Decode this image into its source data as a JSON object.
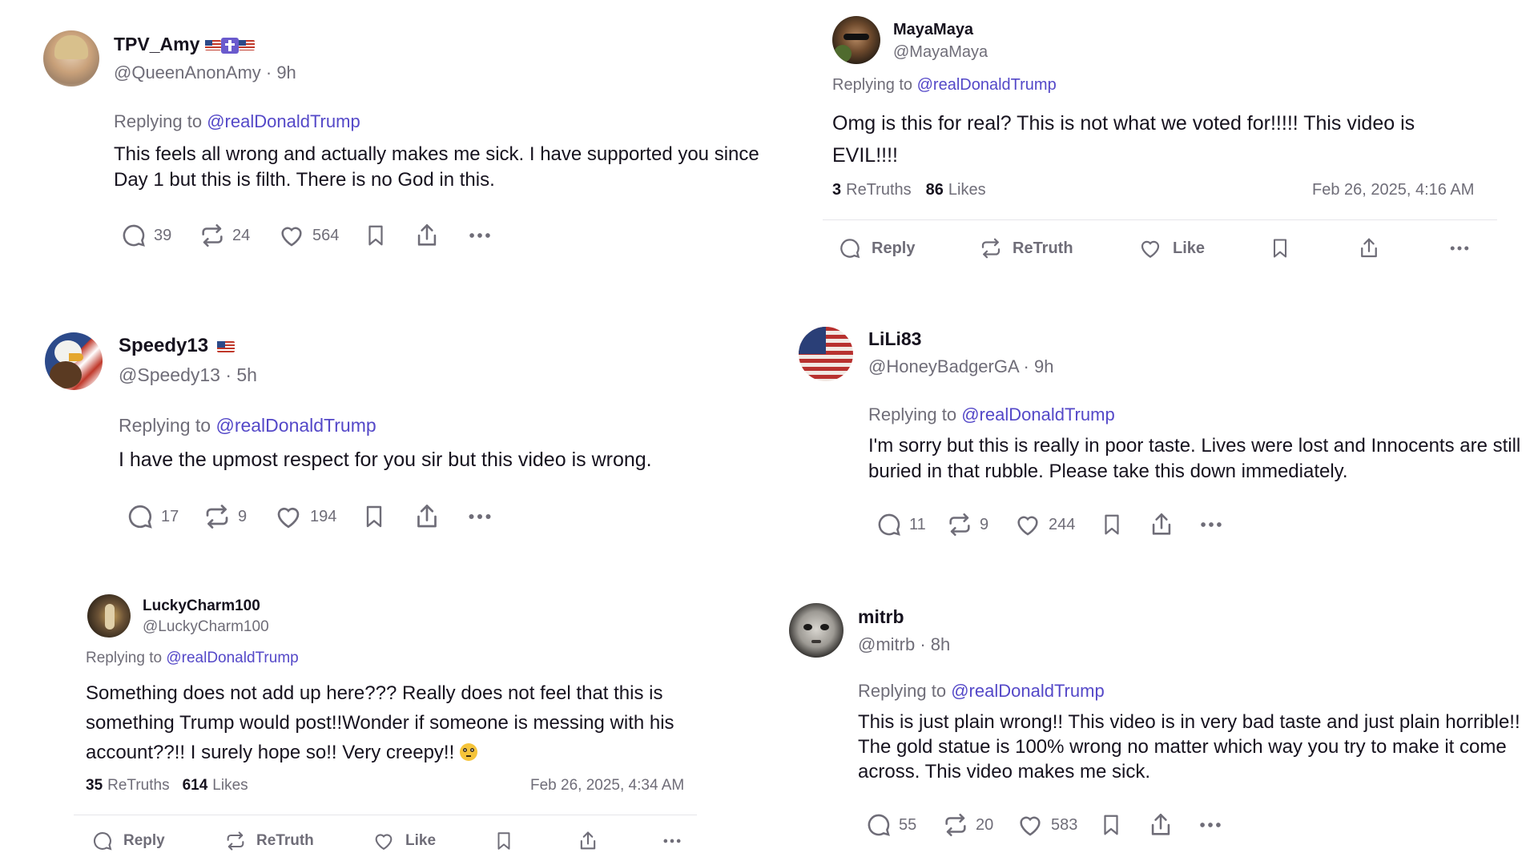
{
  "colors": {
    "text": "#16121e",
    "muted": "#6f6d78",
    "mention": "#5448c8",
    "divider": "#e6e5ea"
  },
  "posts": [
    {
      "name": "TPV_Amy",
      "handle": "@QueenAnonAmy · 9h",
      "replying_label": "Replying to",
      "mention": "@realDonaldTrump",
      "text": "This feels all wrong and actually makes me sick. I have supported you since Day 1 but this is filth. There is no God in this.",
      "replies": "39",
      "retruths": "24",
      "likes": "564"
    },
    {
      "name": "MayaMaya",
      "handle": "@MayaMaya",
      "replying_label": "Replying to",
      "mention": "@realDonaldTrump",
      "text": "Omg is this for real? This is not what we voted for!!!!! This video is EVIL!!!!",
      "retruths_count": "3",
      "retruths_label": "ReTruths",
      "likes_count": "86",
      "likes_label": "Likes",
      "date": "Feb 26, 2025, 4:16 AM",
      "reply_btn": "Reply",
      "retruth_btn": "ReTruth",
      "like_btn": "Like"
    },
    {
      "name": "Speedy13",
      "handle": "@Speedy13 · 5h",
      "replying_label": "Replying to",
      "mention": "@realDonaldTrump",
      "text": "I have the upmost respect for you sir but this video is wrong.",
      "replies": "17",
      "retruths": "9",
      "likes": "194"
    },
    {
      "name": "LiLi83",
      "handle": "@HoneyBadgerGA · 9h",
      "replying_label": "Replying to",
      "mention": "@realDonaldTrump",
      "text": "I'm sorry but this is really in poor taste. Lives were lost and Innocents are still buried in that rubble. Please take this down immediately.",
      "replies": "11",
      "retruths": "9",
      "likes": "244"
    },
    {
      "name": "LuckyCharm100",
      "handle": "@LuckyCharm100",
      "replying_label": "Replying to",
      "mention": "@realDonaldTrump",
      "text": "Something does not add up here??? Really does not feel that this is something Trump would post!!Wonder if someone is messing with his account??!! I surely hope so!! Very creepy!!",
      "retruths_count": "35",
      "retruths_label": "ReTruths",
      "likes_count": "614",
      "likes_label": "Likes",
      "date": "Feb 26, 2025, 4:34 AM",
      "reply_btn": "Reply",
      "retruth_btn": "ReTruth",
      "like_btn": "Like"
    },
    {
      "name": "mitrb",
      "handle": "@mitrb · 8h",
      "replying_label": "Replying to",
      "mention": "@realDonaldTrump",
      "text": "This is just plain wrong!! This video is in very bad taste and just plain horrible!! The gold statue is 100% wrong no matter which way you try to make it come across. This video makes me sick.",
      "replies": "55",
      "retruths": "20",
      "likes": "583"
    }
  ]
}
